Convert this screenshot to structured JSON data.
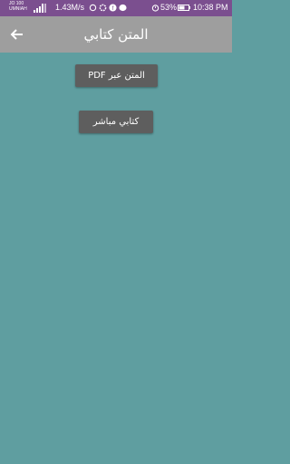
{
  "status_bar": {
    "carrier_line1": "JO 100",
    "carrier_line2": "UMNIAH",
    "speed": "1.43M/s",
    "battery_percent": "53%",
    "time": "10:38 PM",
    "background_color": "#7b4f8f"
  },
  "app_bar": {
    "title": "المتن كتابي",
    "back_icon": "arrow-back-icon",
    "background_color": "#9e9e9e"
  },
  "main": {
    "background_color": "#5f9ea0",
    "buttons": [
      {
        "label": "المتن عبر PDF"
      },
      {
        "label": "كتابي مباشر"
      }
    ]
  }
}
